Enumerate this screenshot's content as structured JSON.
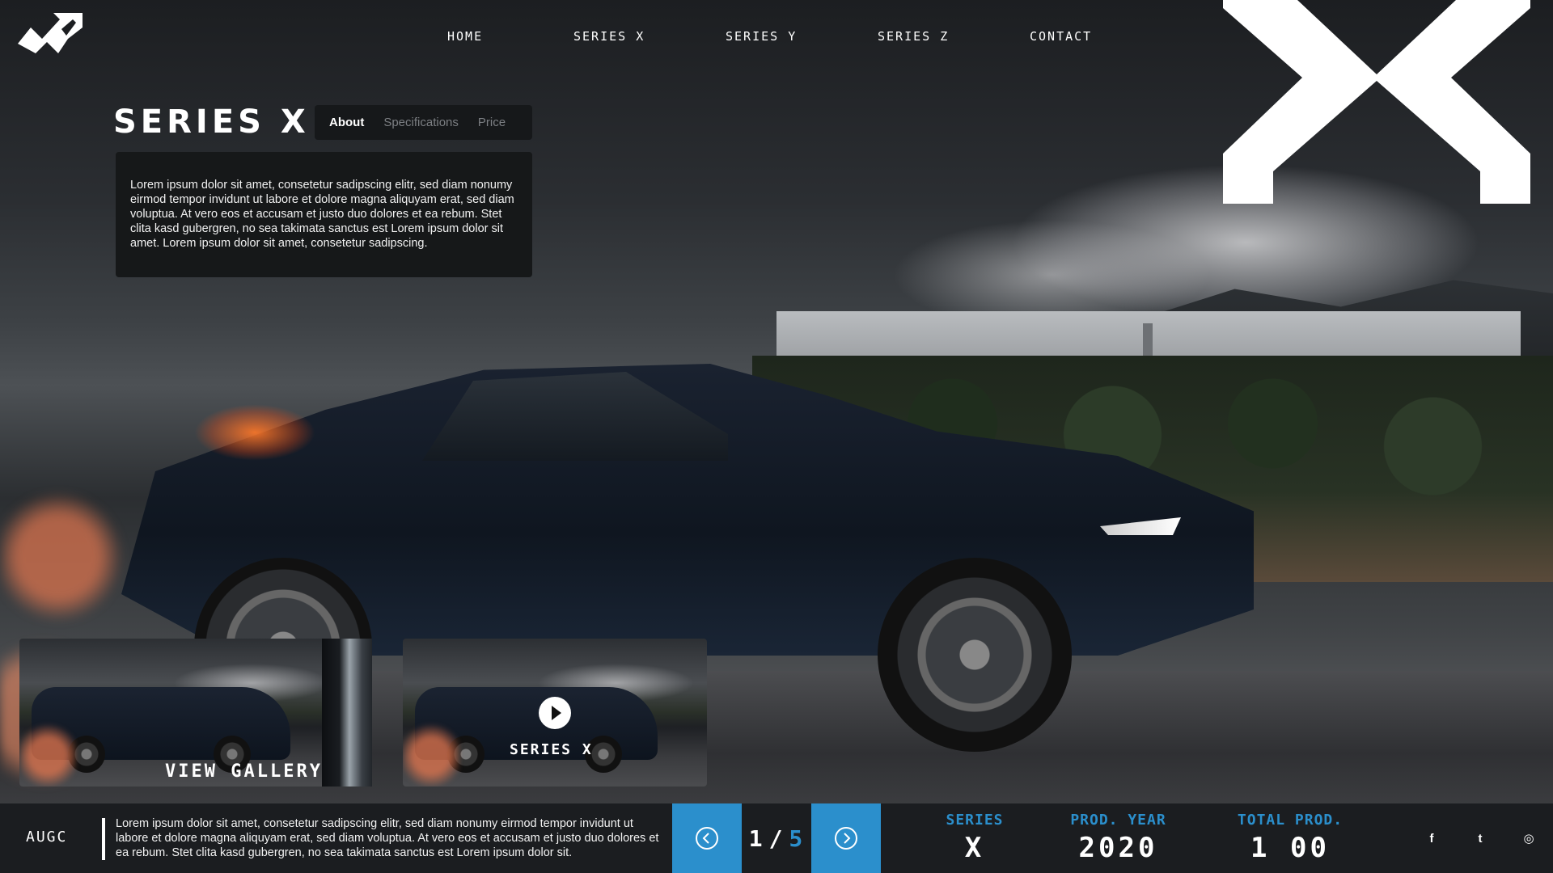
{
  "nav": {
    "items": [
      "Home",
      "Series X",
      "Series Y",
      "Series Z",
      "Contact"
    ]
  },
  "hero": {
    "title": "Series X",
    "tabs": [
      {
        "label": "About",
        "active": true
      },
      {
        "label": "Specifications",
        "active": false
      },
      {
        "label": "Price",
        "active": false
      }
    ],
    "about_text": "Lorem ipsum dolor sit amet, consetetur sadipscing elitr, sed diam nonumy eirmod tempor invidunt ut labore et dolore magna aliquyam erat, sed diam voluptua. At vero eos et accusam et justo duo dolores et ea rebum. Stet clita kasd gubergren, no sea takimata sanctus est Lorem ipsum dolor sit amet. Lorem ipsum dolor sit amet, consetetur sadipscing."
  },
  "thumbnails": {
    "gallery_label": "View Gallery",
    "video_label": "Series X"
  },
  "bottom": {
    "brand_word": "AUGC",
    "text": "Lorem ipsum dolor sit amet, consetetur sadipscing elitr, sed diam nonumy eirmod tempor invidunt ut labore et dolore magna aliquyam erat, sed diam voluptua. At vero eos et accusam et justo duo dolores et ea rebum. Stet clita kasd gubergren, no sea takimata sanctus est Lorem ipsum dolor sit.",
    "pager": {
      "current": "1",
      "separator": "/",
      "total": "5"
    },
    "stats": [
      {
        "label": "Series",
        "value": "X"
      },
      {
        "label": "Prod. Year",
        "value": "2020"
      },
      {
        "label": "Total Prod.",
        "value": "1 00"
      }
    ],
    "socials": [
      {
        "icon": "facebook-icon",
        "glyph": "f"
      },
      {
        "icon": "twitter-icon",
        "glyph": "t"
      },
      {
        "icon": "instagram-icon",
        "glyph": "◎"
      }
    ]
  },
  "colors": {
    "accent": "#2b8fcc",
    "bar": "#1b1d20",
    "card": "#161819"
  }
}
